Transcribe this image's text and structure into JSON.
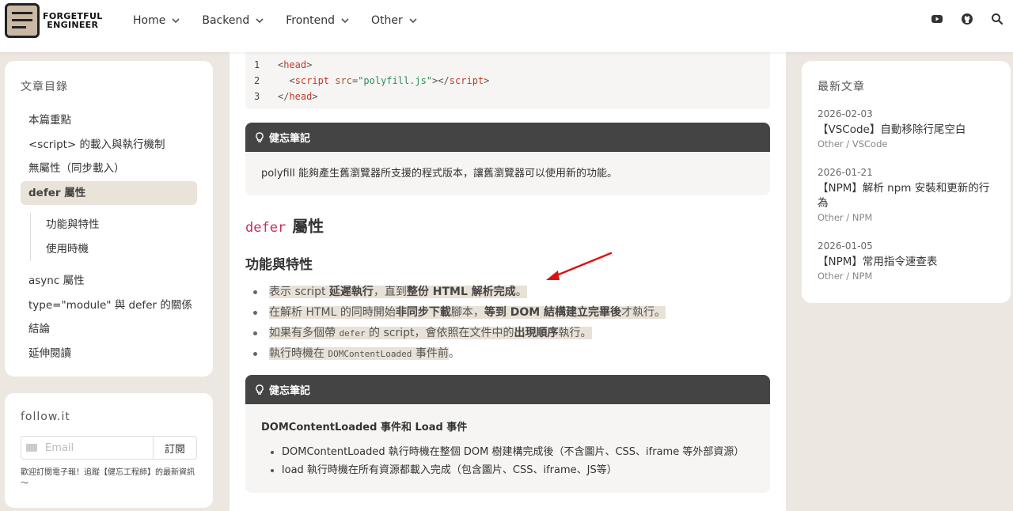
{
  "brand": {
    "line1": "FORGETFUL",
    "line2": "ENGINEER"
  },
  "nav": {
    "items": [
      {
        "label": "Home"
      },
      {
        "label": "Backend"
      },
      {
        "label": "Frontend"
      },
      {
        "label": "Other"
      }
    ]
  },
  "toc": {
    "title": "文章目錄",
    "items": [
      {
        "label": "本篇重點"
      },
      {
        "label": "<script> 的載入與執行機制"
      },
      {
        "label": "無屬性（同步載入）"
      },
      {
        "label": "defer 屬性"
      }
    ],
    "sub_items": [
      {
        "label": "功能與特性"
      },
      {
        "label": "使用時機"
      }
    ],
    "items_after": [
      {
        "label": "async 屬性"
      },
      {
        "label": "type=\"module\" 與 defer 的關係"
      },
      {
        "label": "結論"
      },
      {
        "label": "延伸閱讀"
      }
    ]
  },
  "follow": {
    "title": "follow.it",
    "email_placeholder": "Email",
    "subscribe_label": "訂閱",
    "note": "歡迎訂閱電子報！追蹤【健忘工程師】的最新資訊～"
  },
  "code_block": {
    "lines": [
      {
        "num": "1",
        "indent": "",
        "open": "<",
        "tag": "head",
        "close": ">"
      },
      {
        "num": "2",
        "indent": "  ",
        "open": "<",
        "tag": "script",
        "attr": " src",
        "eq": "=",
        "value": "\"polyfill.js\"",
        "end": "></",
        "tag2": "script",
        "close": ">"
      },
      {
        "num": "3",
        "indent": "",
        "open": "</",
        "tag": "head",
        "close": ">"
      }
    ]
  },
  "note1": {
    "title": "健忘筆記",
    "body": "polyfill 能夠產生舊瀏覽器所支援的程式版本，讓舊瀏覽器可以使用新的功能。"
  },
  "section": {
    "code_word": "defer",
    "heading_suffix": "屬性",
    "subheading": "功能與特性"
  },
  "bullets": [
    {
      "parts": [
        "表示 script ",
        "延遲執行",
        "，直到",
        "整份 HTML 解析完成",
        "。"
      ]
    },
    {
      "parts": [
        "在解析 HTML 的同時開始",
        "非同步下載",
        "腳本，",
        "等到 DOM 結構建立完畢後",
        "才執行。"
      ]
    },
    {
      "parts": [
        "如果有多個帶 ",
        "defer",
        " 的 script，會依照在文件中的",
        "出現順序",
        "執行。"
      ]
    },
    {
      "parts": [
        "執行時機在 ",
        "DOMContentLoaded",
        " 事件前",
        "。"
      ]
    }
  ],
  "note2": {
    "title": "健忘筆記",
    "subtitle": "DOMContentLoaded 事件和 Load 事件",
    "items": [
      "DOMContentLoaded 執行時機在整個 DOM 樹建構完成後（不含圖片、CSS、iframe 等外部資源）",
      "load 執行時機在所有資源都載入完成（包含圖片、CSS、iframe、JS等）"
    ]
  },
  "recent": {
    "title": "最新文章",
    "posts": [
      {
        "date": "2026-02-03",
        "title": "【VSCode】自動移除行尾空白",
        "category": "Other / VSCode"
      },
      {
        "date": "2026-01-21",
        "title": "【NPM】解析 npm 安裝和更新的行為",
        "category": "Other / NPM"
      },
      {
        "date": "2026-01-05",
        "title": "【NPM】常用指令速查表",
        "category": "Other / NPM"
      }
    ]
  },
  "colors": {
    "accent_code": "#c0325a",
    "highlight": "#e8e1d7",
    "note_header": "#444444",
    "arrow": "#e01010"
  },
  "icons": {
    "header": [
      "youtube-icon",
      "github-icon",
      "search-icon"
    ],
    "note": "lightbulb-icon",
    "nav": "chevron-down-icon",
    "email": "mail-icon"
  }
}
